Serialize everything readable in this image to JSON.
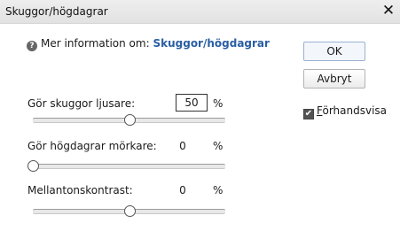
{
  "window": {
    "title": "Skuggor/högdagrar",
    "close_glyph": "✕"
  },
  "info": {
    "prefix": "Mer information om:",
    "link": "Skuggor/högdagrar",
    "icon": "help-icon"
  },
  "sliders": [
    {
      "label": "Gör skuggor ljusare:",
      "value": "50",
      "unit": "%",
      "editable": true,
      "percent": 50
    },
    {
      "label": "Gör högdagrar mörkare:",
      "value": "0",
      "unit": "%",
      "editable": false,
      "percent": 0
    },
    {
      "label": "Mellantonskontrast:",
      "value": "0",
      "unit": "%",
      "editable": false,
      "percent": 50
    }
  ],
  "buttons": {
    "ok": "OK",
    "cancel": "Avbryt"
  },
  "preview": {
    "label_first": "F",
    "label_rest": "örhandsvisa",
    "checked": true
  }
}
